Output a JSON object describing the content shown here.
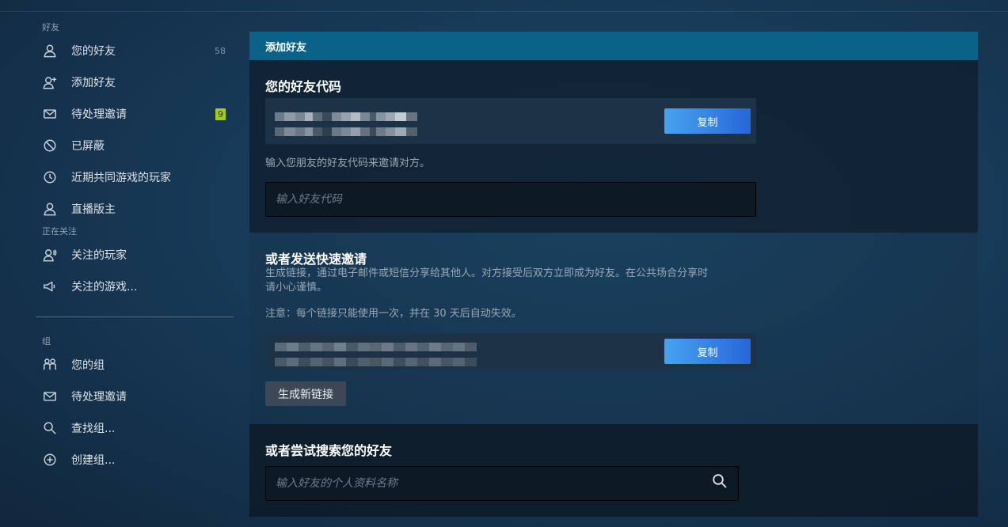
{
  "sidebar": {
    "friends_header": "好友",
    "friends_items": [
      {
        "label": "您的好友",
        "icon": "person-icon",
        "count": "58"
      },
      {
        "label": "添加好友",
        "icon": "add-person-icon"
      },
      {
        "label": "待处理邀请",
        "icon": "envelope-icon",
        "badge": "9"
      },
      {
        "label": "已屏蔽",
        "icon": "block-icon"
      },
      {
        "label": "近期共同游戏的玩家",
        "icon": "clock-icon"
      },
      {
        "label": "直播版主",
        "icon": "person-icon"
      }
    ],
    "following_header": "正在关注",
    "following_items": [
      {
        "label": "关注的玩家",
        "icon": "followed-person-icon"
      },
      {
        "label": "关注的游戏...",
        "icon": "megaphone-icon"
      }
    ],
    "groups_header": "组",
    "groups_items": [
      {
        "label": "您的组",
        "icon": "group-icon"
      },
      {
        "label": "待处理邀请",
        "icon": "envelope-icon"
      },
      {
        "label": "查找组...",
        "icon": "search-icon"
      },
      {
        "label": "创建组...",
        "icon": "plus-circle-icon"
      }
    ]
  },
  "main": {
    "header_title": "添加好友",
    "friend_code": {
      "title": "您的好友代码",
      "copy_label": "复制",
      "hint": "输入您朋友的好友代码来邀请对方。",
      "input_placeholder": "输入好友代码"
    },
    "quick_invite": {
      "title": "或者发送快速邀请",
      "description_line1": "生成链接，通过电子邮件或短信分享给其他人。对方接受后双方立即成为好友。在公共场合分享时",
      "description_line2": "请小心谨慎。",
      "note": "注意：每个链接只能使用一次，并在 30 天后自动失效。",
      "copy_label": "复制",
      "generate_label": "生成新链接"
    },
    "search": {
      "title": "或者尝试搜索您的好友",
      "input_placeholder": "输入好友的个人资料名称"
    }
  },
  "colors": {
    "header_bar": "#0b6288",
    "copy_button_start": "#47a3f0",
    "copy_button_end": "#2767d8",
    "badge": "#a4d007"
  }
}
